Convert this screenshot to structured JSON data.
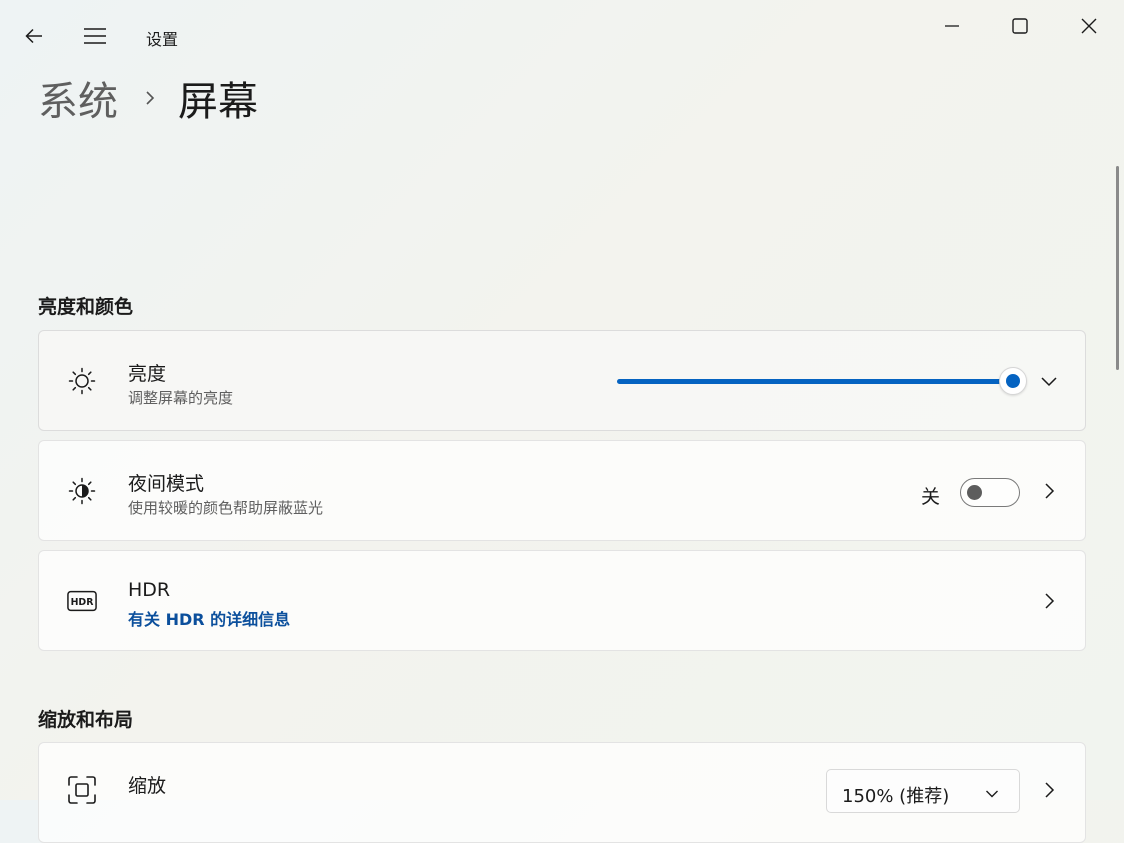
{
  "window": {
    "app_title": "设置",
    "controls": [
      "minimize-icon",
      "maximize-icon",
      "close-icon"
    ]
  },
  "breadcrumb": {
    "parent": "系统",
    "current": "屏幕"
  },
  "sections": {
    "brightness_color": {
      "title": "亮度和颜色",
      "brightness": {
        "icon": "sun-icon",
        "title": "亮度",
        "subtitle": "调整屏幕的亮度",
        "value_percent": 100
      },
      "night_light": {
        "icon": "night-light-icon",
        "title": "夜间模式",
        "subtitle": "使用较暖的颜色帮助屏蔽蓝光",
        "state_label": "关",
        "enabled": false
      },
      "hdr": {
        "icon": "hdr-icon",
        "title": "HDR",
        "link": "有关 HDR 的详细信息"
      }
    },
    "scale_layout": {
      "title": "缩放和布局",
      "scale": {
        "icon": "scale-icon",
        "title": "缩放",
        "selected": "150% (推荐)"
      }
    }
  },
  "colors": {
    "accent": "#0563c1",
    "link": "#0b4f9c"
  }
}
